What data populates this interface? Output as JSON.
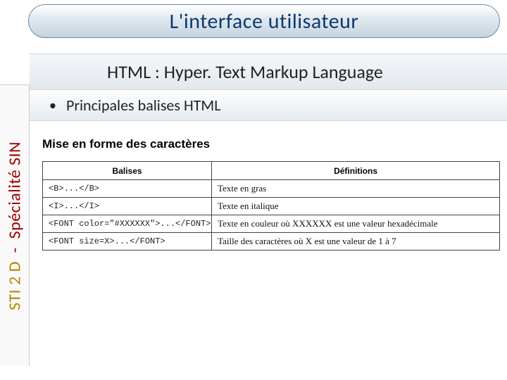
{
  "title": "L'interface utilisateur",
  "sidebar": {
    "part1": "STI 2 D",
    "dash": "-",
    "part2": "Spécialité SIN"
  },
  "subtitle": "HTML : Hyper. Text Markup Language",
  "bullet": "Principales balises HTML",
  "section_heading": "Mise en forme des caractères",
  "table": {
    "headers": {
      "col1": "Balises",
      "col2": "Définitions"
    },
    "rows": [
      {
        "balise": "<B>...</B>",
        "def": "Texte en gras"
      },
      {
        "balise": "<I>...</I>",
        "def": "Texte en italique"
      },
      {
        "balise": "<FONT color=\"#XXXXXX\">...</FONT>",
        "def": "Texte en couleur où XXXXXX est une valeur hexadécimale"
      },
      {
        "balise": "<FONT size=X>...</FONT>",
        "def": "Taille des caractères où X est une valeur de 1 à 7"
      }
    ]
  }
}
